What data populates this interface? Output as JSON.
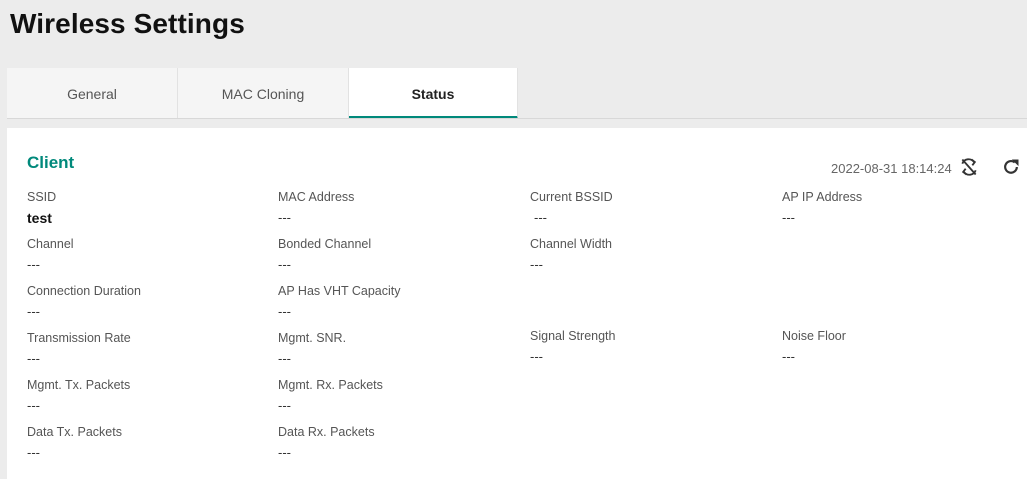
{
  "page": {
    "title": "Wireless Settings"
  },
  "tabs": [
    {
      "label": "General",
      "active": false
    },
    {
      "label": "MAC Cloning",
      "active": false
    },
    {
      "label": "Status",
      "active": true
    }
  ],
  "section": {
    "title": "Client",
    "timestamp": "2022-08-31 18:14:24",
    "icons": [
      "sync-off-icon",
      "refresh-icon"
    ]
  },
  "fields": {
    "ssid": {
      "label": "SSID",
      "value": "test"
    },
    "mac_address": {
      "label": "MAC Address",
      "value": "---"
    },
    "current_bssid": {
      "label": "Current BSSID",
      "value": "---"
    },
    "ap_ip_address": {
      "label": "AP IP Address",
      "value": "---"
    },
    "channel": {
      "label": "Channel",
      "value": "---"
    },
    "bonded_channel": {
      "label": "Bonded Channel",
      "value": "---"
    },
    "channel_width": {
      "label": "Channel Width",
      "value": "---"
    },
    "connection_duration": {
      "label": "Connection Duration",
      "value": "---"
    },
    "ap_vht_capacity": {
      "label": "AP Has VHT Capacity",
      "value": "---"
    },
    "transmission_rate": {
      "label": "Transmission Rate",
      "value": "---"
    },
    "mgmt_snr": {
      "label": "Mgmt. SNR.",
      "value": "---"
    },
    "signal_strength": {
      "label": "Signal Strength",
      "value": "---"
    },
    "noise_floor": {
      "label": "Noise Floor",
      "value": "---"
    },
    "mgmt_tx_packets": {
      "label": "Mgmt. Tx. Packets",
      "value": "---"
    },
    "mgmt_rx_packets": {
      "label": "Mgmt. Rx. Packets",
      "value": "---"
    },
    "data_tx_packets": {
      "label": "Data Tx. Packets",
      "value": "---"
    },
    "data_rx_packets": {
      "label": "Data Rx. Packets",
      "value": "---"
    }
  },
  "colors": {
    "accent": "#00897b",
    "background": "#ececec",
    "panel": "#ffffff"
  }
}
